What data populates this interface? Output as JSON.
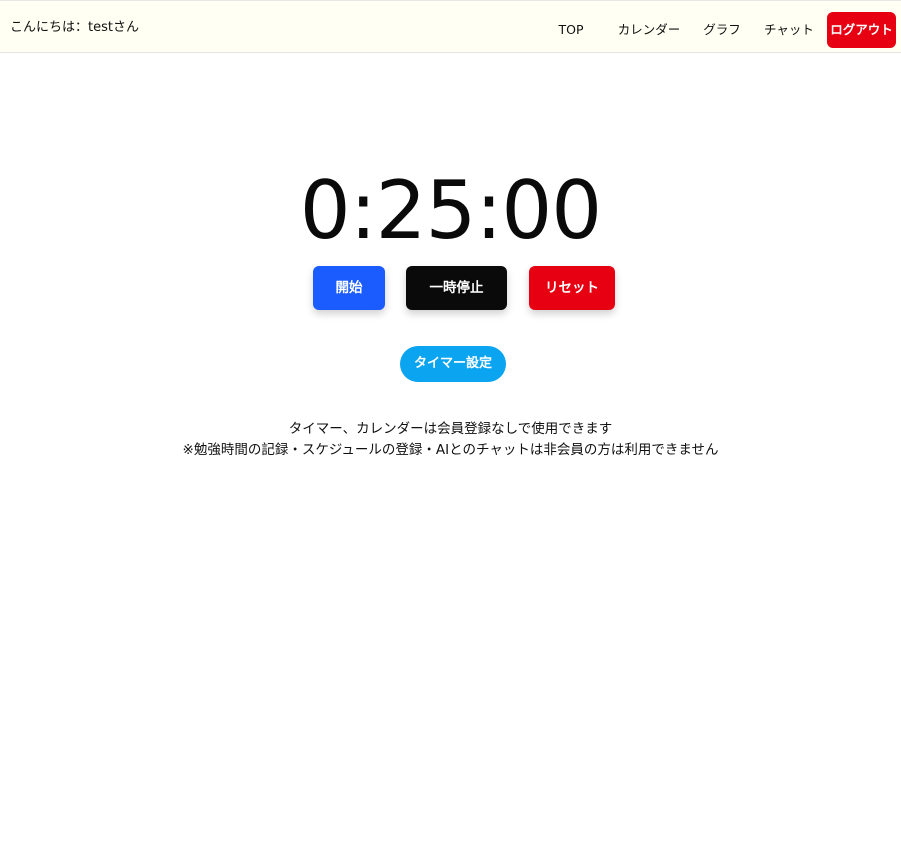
{
  "header": {
    "greeting": "こんにちは：testさん",
    "nav": {
      "top": "TOP",
      "calendar": "カレンダー",
      "graph": "グラフ",
      "chat": "チャット",
      "logout": "ログアウト"
    }
  },
  "timer": {
    "display": "0:25:00",
    "start_label": "開始",
    "pause_label": "一時停止",
    "reset_label": "リセット",
    "settings_label": "タイマー設定"
  },
  "notice": {
    "line1": "タイマー、カレンダーは会員登録なしで使用できます",
    "line2": "※勉強時間の記録・スケジュールの登録・AIとのチャットは非会員の方は利用できません"
  },
  "colors": {
    "header_bg": "#fffff3",
    "start": "#1a5cff",
    "pause": "#0a0a0a",
    "reset": "#e60012",
    "logout": "#e60012",
    "settings": "#0aa4f0"
  }
}
